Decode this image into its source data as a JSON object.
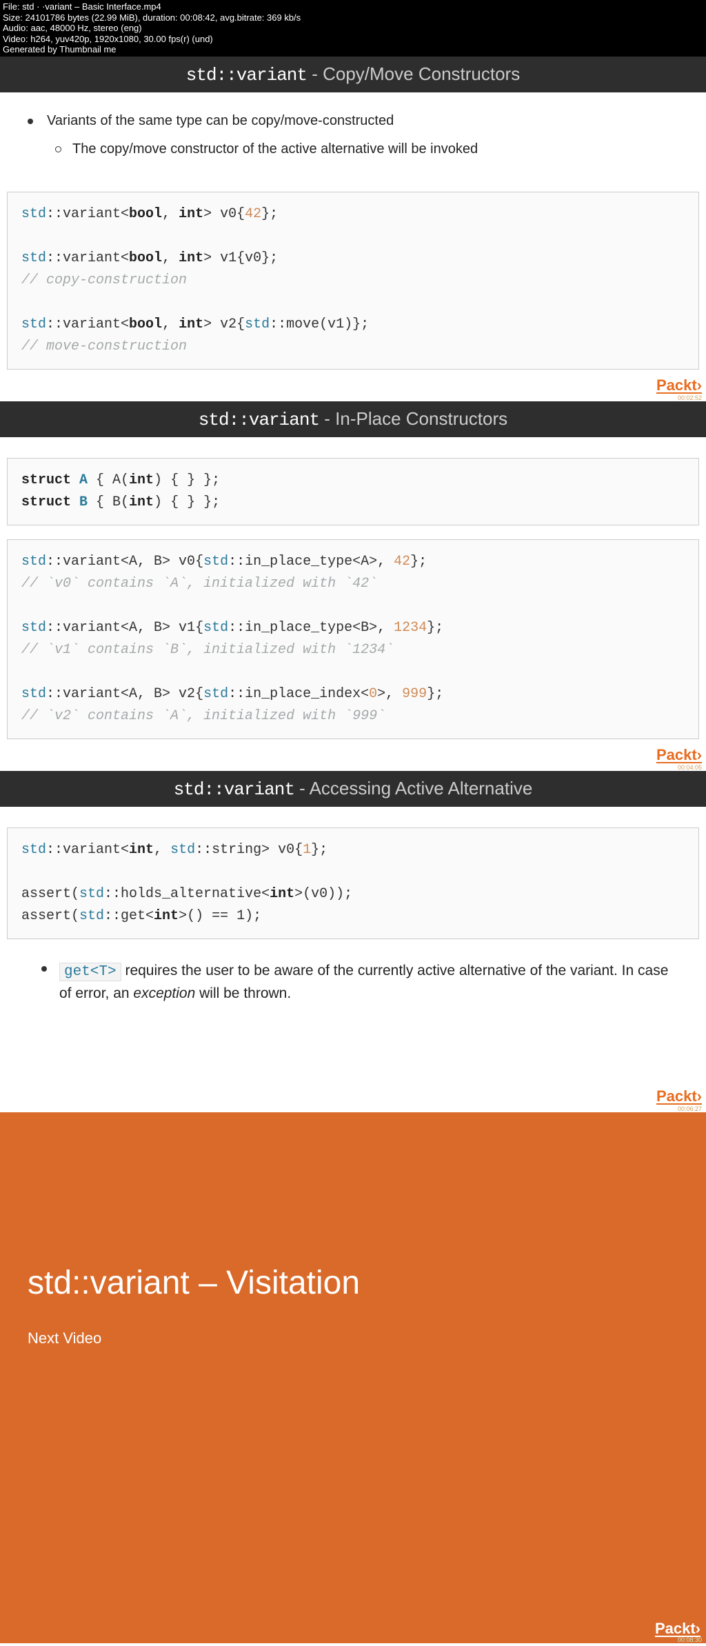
{
  "meta": {
    "l1": "File: std · ·variant – Basic Interface.mp4",
    "l2": "Size: 24101786 bytes (22.99 MiB), duration: 00:08:42, avg.bitrate: 369 kb/s",
    "l3": "Audio: aac, 48000 Hz, stereo (eng)",
    "l4": "Video: h264, yuv420p, 1920x1080, 30.00 fps(r) (und)",
    "l5": "Generated by Thumbnail me"
  },
  "s1": {
    "title_hl": "std::variant",
    "title_rest": "  -  Copy/Move Constructors",
    "b1": "Variants of the same type can be copy/move-constructed",
    "b2": "The copy/move constructor of the active alternative will be invoked",
    "brand": "Packt›",
    "ts": "00:02:52"
  },
  "code1": {
    "std": "std",
    "sep": "::",
    "variant": "variant<",
    "bool": "bool",
    "comma": ", ",
    "int": "int",
    "close": "> v0{",
    "n42": "42",
    "end": "};",
    "v1": "> v1{v0};",
    "cmt1": "// copy-construction",
    "v2a": "> v2{",
    "mv": "::move(v1)};",
    "cmt2": "// move-construction"
  },
  "s2": {
    "title_hl": "std::variant",
    "title_rest": "  -  In-Place Constructors",
    "brand": "Packt›",
    "ts": "00:04:05"
  },
  "code2a": {
    "struct": "struct ",
    "A": "A",
    "Abody": " { A(",
    "int": "int",
    "rest": ") { } };",
    "B": "B",
    "Bbody": " { B("
  },
  "code2b": {
    "std": "std",
    "sep": "::",
    "var": "variant<A, B> v0{",
    "ipt": "::in_place_type<A>, ",
    "n42": "42",
    "end": "};",
    "cmt1": "// `v0` contains `A`, initialized with `42`",
    "var1": "variant<A, B> v1{",
    "iptb": "::in_place_type<B>, ",
    "n1234": "1234",
    "cmt2": "// `v1` contains `B`, initialized with `1234`",
    "var2": "variant<A, B> v2{",
    "ipi": "::in_place_index<",
    "zero": "0",
    "ipiend": ">, ",
    "n999": "999",
    "cmt3": "// `v2` contains `A`, initialized with `999`"
  },
  "s3": {
    "title_hl": "std::variant",
    "title_rest": "  -  Accessing Active Alternative",
    "brand": "Packt›",
    "ts": "00:06:27"
  },
  "code3": {
    "std": "std",
    "sep": "::",
    "var": "variant<",
    "int": "int",
    "comma": ", ",
    "str": "::string",
    "close": "> v0{",
    "one": "1",
    "end": "};",
    "assert": "assert(",
    "ha": "::holds_alternative<",
    "haend": ">(v0));",
    "get": "::get<",
    "getend": ">() == 1);"
  },
  "note": {
    "code": "get<T>",
    "t1": " requires the user to be aware of the currently active alternative of the variant. In case of error, an ",
    "em": "exception",
    "t2": " will be thrown."
  },
  "s4": {
    "title": "std::variant – Visitation",
    "sub": "Next Video",
    "brand": "Packt›",
    "ts": "00:08:30"
  }
}
